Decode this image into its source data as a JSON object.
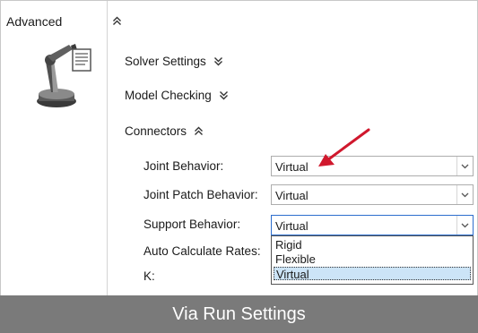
{
  "panel": {
    "section_title": "Advanced",
    "collapse_glyph": "⌃"
  },
  "subsections": {
    "solver": {
      "label": "Solver Settings",
      "state": "collapsed"
    },
    "model_checking": {
      "label": "Model Checking",
      "state": "collapsed"
    },
    "connectors": {
      "label": "Connectors",
      "state": "expanded"
    }
  },
  "fields": {
    "joint_behavior": {
      "label": "Joint Behavior:",
      "value": "Virtual"
    },
    "joint_patch_behavior": {
      "label": "Joint Patch Behavior:",
      "value": "Virtual"
    },
    "support_behavior": {
      "label": "Support Behavior:",
      "value": "Virtual"
    },
    "auto_calculate_rates": {
      "label": "Auto Calculate Rates:"
    },
    "k": {
      "label": "K:"
    }
  },
  "dropdown": {
    "options": [
      "Rigid",
      "Flexible",
      "Virtual"
    ],
    "selected_index": 2
  },
  "banner": {
    "text": "Via Run Settings"
  },
  "colors": {
    "banner_bg": "#7a7a7a",
    "annotation_arrow": "#d0182d",
    "selection": "#cce4f7"
  },
  "icons": {
    "section_icon": "robot-arm-icon",
    "expand": "double-chevron-down-icon",
    "collapse": "double-chevron-up-icon",
    "dropdown": "chevron-down-icon"
  }
}
